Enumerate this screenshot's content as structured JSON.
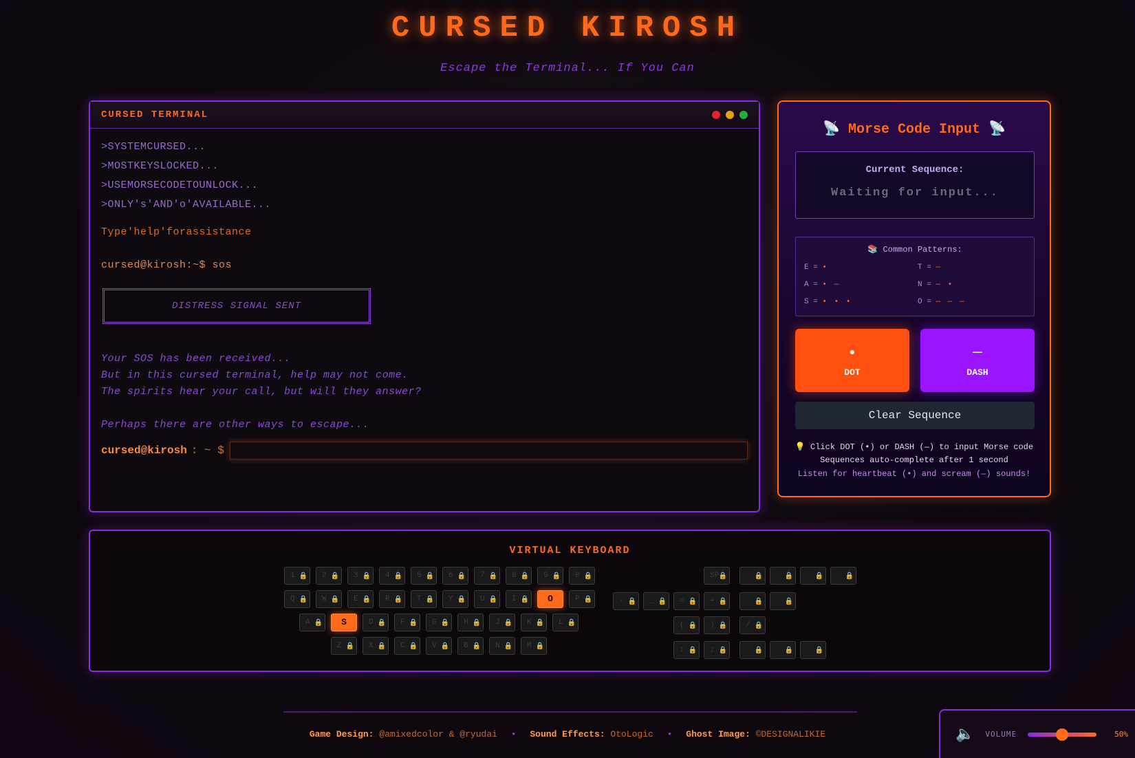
{
  "header": {
    "title": "CURSED KIROSH",
    "subtitle": "Escape the Terminal... If You Can"
  },
  "terminal": {
    "title": "CURSED TERMINAL",
    "window_dots": [
      "#e0242a",
      "#e0a020",
      "#20b040"
    ],
    "system_lines": [
      ">SYSTEMCURSED...",
      ">MOSTKEYSLOCKED...",
      ">USEMORSECODETOUNLOCK...",
      ">ONLY's'AND'o'AVAILABLE..."
    ],
    "help_line": "Type'help'forassistance",
    "command_line": "cursed@kirosh:~$ sos",
    "distress_text": "DISTRESS SIGNAL SENT",
    "response_lines": [
      "Your SOS has been received...",
      "But in this cursed terminal, help may not come.",
      "The spirits hear your call, but will they answer?"
    ],
    "escape_line": "Perhaps there are other ways to escape...",
    "prompt": {
      "user": "cursed@kirosh",
      "separator": ": ~ $",
      "value": ""
    }
  },
  "morse": {
    "title": "📡 Morse Code Input 📡",
    "sequence_label": "Current Sequence:",
    "sequence_value": "Waiting for input...",
    "patterns_title": "📚 Common Patterns:",
    "patterns": [
      {
        "letter": "E =",
        "code": "•"
      },
      {
        "letter": "T =",
        "code": "—"
      },
      {
        "letter": "A =",
        "code": "• —"
      },
      {
        "letter": "N =",
        "code": "— •"
      },
      {
        "letter": "S =",
        "code": "• • •"
      },
      {
        "letter": "O =",
        "code": "— — —"
      }
    ],
    "dot_symbol": "●",
    "dot_label": "DOT",
    "dash_symbol": "—",
    "dash_label": "DASH",
    "clear_label": "Clear Sequence",
    "hints": [
      "💡 Click DOT (•) or DASH (—) to input Morse code",
      "Sequences auto-complete after 1 second",
      "Listen for heartbeat (•) and scream (—) sounds!"
    ]
  },
  "keyboard": {
    "title": "VIRTUAL KEYBOARD",
    "lock_icon": "🔒",
    "rows": [
      [
        "1",
        "2",
        "3",
        "4",
        "5",
        "6",
        "7",
        "8",
        "9",
        "0"
      ],
      [
        "Q",
        "W",
        "E",
        "R",
        "T",
        "Y",
        "U",
        "I",
        "O",
        "P"
      ],
      [
        "A",
        "S",
        "D",
        "F",
        "G",
        "H",
        "J",
        "K",
        "L"
      ],
      [
        "Z",
        "X",
        "C",
        "V",
        "B",
        "N",
        "M"
      ]
    ],
    "active_keys": [
      "S",
      "O"
    ],
    "symbol_keys": {
      "top": [
        "SP"
      ],
      "row2": [
        "-",
        "_",
        "=",
        "+"
      ],
      "row3": [
        "(",
        ")"
      ],
      "row4": [
        ":",
        ";"
      ]
    },
    "side_keys": {
      "row1": [
        "",
        "",
        "",
        ""
      ],
      "row2": [
        "",
        ""
      ],
      "row3": [
        "/"
      ],
      "row4": [
        "",
        "",
        ""
      ]
    }
  },
  "footer": {
    "credits": [
      {
        "key": "Game Design:",
        "value": "@amixedcolor & @ryudai"
      },
      {
        "key": "Sound Effects:",
        "value": "OtoLogic"
      },
      {
        "key": "Ghost Image:",
        "value": "©DESIGNALIKIE"
      }
    ],
    "separator": "•"
  },
  "volume": {
    "icon": "speaker-icon",
    "label": "VOLUME",
    "value": 50,
    "display": "50%"
  }
}
